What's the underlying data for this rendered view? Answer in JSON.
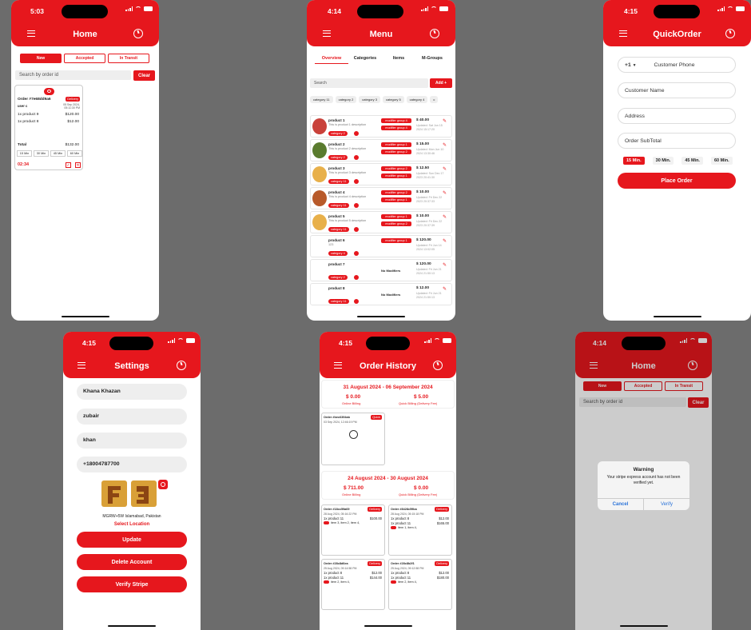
{
  "colors": {
    "accent": "#e6171d"
  },
  "home": {
    "time": "5:03",
    "title": "Home",
    "tabs": [
      "New",
      "Accepted",
      "In Transit"
    ],
    "search_placeholder": "Search by order id",
    "clear": "Clear",
    "order": {
      "id": "Order #7e68dd9a6",
      "badge": "Delivery",
      "date": "05 Sep 2024, 05:11:30 PM",
      "user": "user c",
      "items": [
        {
          "name": "1x product 9",
          "price": "$120.00"
        },
        {
          "name": "1x product 8",
          "price": "$12.00"
        }
      ],
      "total_label": "Total",
      "total": "$132.00",
      "eta": [
        "15 Min",
        "30 Min",
        "45 Min",
        "60 Min"
      ],
      "timer": "02:34"
    }
  },
  "menu": {
    "time": "4:14",
    "title": "Menu",
    "tabs": [
      "Overview",
      "Categories",
      "Items",
      "M-Groups"
    ],
    "search_placeholder": "Search",
    "add": "Add +",
    "chips": [
      "category 11",
      "category 2",
      "category 3",
      "category 5",
      "category 4",
      "c"
    ],
    "products": [
      {
        "name": "product 1",
        "desc": "This is product 1 description",
        "cat": "category 2",
        "mods": [
          "modifier group 4",
          "modifier group 4"
        ],
        "price": "$ 40.00",
        "updated": "Updated: Sat Jun 15 2024 15:17:20"
      },
      {
        "name": "product 2",
        "desc": "This is product 2 description",
        "cat": "category 2",
        "mods": [
          "modifier group 1",
          "modifier group 2"
        ],
        "price": "$ 15.00",
        "updated": "Updated: Mon Jun 10 2024 13:30:46"
      },
      {
        "name": "product 3",
        "desc": "This is product 3 description",
        "cat": "category 11",
        "mods": [
          "modifier group 2",
          "modifier group 1"
        ],
        "price": "$ 12.50",
        "updated": "Updated: Sun Dec 17 2023 20:41:30"
      },
      {
        "name": "product 4",
        "desc": "This is product 4 description",
        "cat": "category 11",
        "mods": [
          "modifier group 2",
          "modifier group 1"
        ],
        "price": "$ 10.00",
        "updated": "Updated: Fri Dec 22 2023 20:37:33"
      },
      {
        "name": "product 5",
        "desc": "This is product 5 description",
        "cat": "category 11",
        "mods": [
          "modifier group 1",
          "modifier group 2"
        ],
        "price": "$ 10.00",
        "updated": "Updated: Fri Dec 22 2023 20:37:39"
      },
      {
        "name": "product 6",
        "desc": "123",
        "cat": "category 4",
        "mods": [
          "modifier group 1"
        ],
        "price": "$ 120.00",
        "updated": "Updated: Fri Jun 14 2024 13:02:05"
      },
      {
        "name": "product 7",
        "desc": "",
        "cat": "category 2",
        "mods": [],
        "nomod": "No Modifiers",
        "price": "$ 120.00",
        "updated": "Updated: Fri Jun 21 2024 21:50:13"
      },
      {
        "name": "product 8",
        "desc": "",
        "cat": "category 11",
        "mods": [],
        "nomod": "No Modifiers",
        "price": "$ 12.00",
        "updated": "Updated: Fri Jun 21 2024 21:50:13"
      }
    ]
  },
  "quick": {
    "time": "4:15",
    "title": "QuickOrder",
    "country_code": "+1",
    "phone_placeholder": "Customer Phone",
    "name_placeholder": "Customer Name",
    "address_placeholder": "Address",
    "subtotal_placeholder": "Order SubTotal",
    "eta": [
      "15 Min.",
      "30 Min.",
      "45 Min.",
      "60 Min."
    ],
    "place": "Place Order"
  },
  "settings": {
    "time": "4:15",
    "title": "Settings",
    "fields": [
      "Khana Khazan",
      "zubair",
      "khan",
      "+18004787700"
    ],
    "address": "MGRW+5W Islamabad, Pakistan",
    "select_location": "Select Location",
    "update": "Update",
    "delete": "Delete Account",
    "verify": "Verify Stripe"
  },
  "history": {
    "time": "4:15",
    "title": "Order History",
    "week1": {
      "range": "31 August 2024 - 06 September 2024",
      "online": "$ 0.00",
      "online_label": "Online Billing",
      "quick": "$ 5.00",
      "quick_label": "Quick Billing (Delivery Fee)",
      "order": {
        "id": "Order #bec6394ab",
        "badge": "Quick",
        "date": "03 Sep 2024, 12:46:19 PM"
      }
    },
    "week2": {
      "range": "24 August 2024 - 30 August 2024",
      "online": "$ 711.00",
      "online_label": "Online Billing",
      "quick": "$ 0.00",
      "quick_label": "Quick Billing (Delivery Fee)",
      "orders": [
        {
          "id": "Order #18cc59a69",
          "badge": "Delivery",
          "date": "28 Aug 2024, 05:16:22 PM",
          "items": [
            {
              "name": "1x product 11",
              "price": "$100.00"
            }
          ],
          "mods": "item 3, item 2, item 4,"
        },
        {
          "id": "Order #8428c59ba",
          "badge": "Delivery",
          "date": "28 Aug 2024, 05:15:18 PM",
          "items": [
            {
              "name": "1x product 8",
              "price": "$12.00"
            },
            {
              "name": "1x product 11",
              "price": "$165.00"
            }
          ],
          "mods": "item 1, item 4,"
        },
        {
          "id": "Order #28c8d6ea",
          "badge": "Delivery",
          "date": "25 Aug 2024, 09:14:58 PM",
          "items": [
            {
              "name": "1x product 8",
              "price": "$12.00"
            },
            {
              "name": "1x product 11",
              "price": "$144.00"
            }
          ],
          "mods": "item 2, item 4,"
        },
        {
          "id": "Order #28c8b2f1",
          "badge": "Delivery",
          "date": "25 Aug 2024, 09:12:58 PM",
          "items": [
            {
              "name": "1x product 8",
              "price": "$12.00"
            },
            {
              "name": "1x product 11",
              "price": "$180.00"
            }
          ],
          "mods": "item 2, item 4,"
        }
      ]
    }
  },
  "alert_home": {
    "time": "4:14",
    "title": "Home",
    "tabs": [
      "New",
      "Accepted",
      "In Transit"
    ],
    "search_placeholder": "Search by order id",
    "clear": "Clear",
    "alert_title": "Warning",
    "alert_msg": "Your stripe express account has not been verified yet.",
    "cancel": "Cancel",
    "verify": "Verify"
  }
}
